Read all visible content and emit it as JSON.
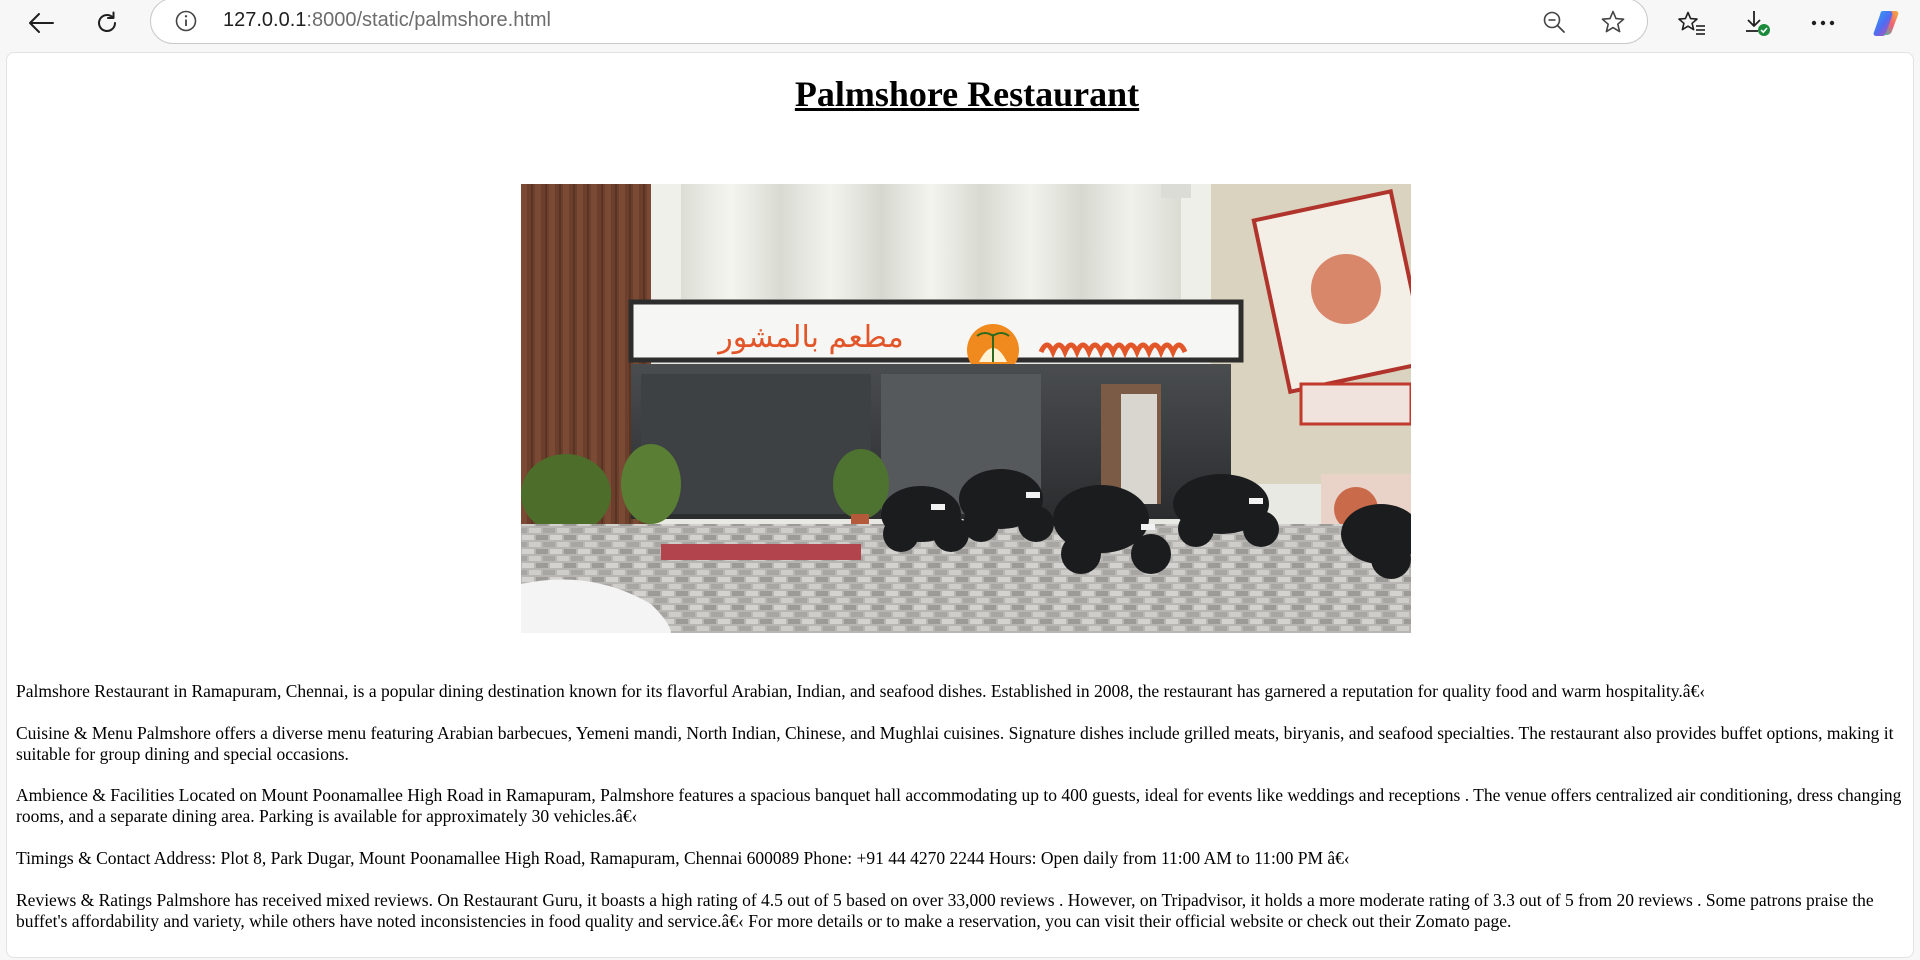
{
  "browser": {
    "url_host": "127.0.0.1",
    "url_path": ":8000/static/palmshore.html",
    "icons": [
      "back-arrow-icon",
      "refresh-icon",
      "site-info-icon",
      "zoom-out-icon",
      "favorite-star-icon",
      "favorites-list-icon",
      "downloads-icon",
      "more-menu-icon",
      "copilot-icon"
    ]
  },
  "page": {
    "title": "Palmshore Restaurant",
    "image_alt": "Palmshore Restaurant storefront",
    "sign_arabic": "مطعم بالمشور",
    "paragraphs": [
      "Palmshore Restaurant in Ramapuram, Chennai, is a popular dining destination known for its flavorful Arabian, Indian, and seafood dishes. Established in 2008, the restaurant has garnered a reputation for quality food and warm hospitality.â€‹",
      "Cuisine & Menu Palmshore offers a diverse menu featuring Arabian barbecues, Yemeni mandi, North Indian, Chinese, and Mughlai cuisines. Signature dishes include grilled meats, biryanis, and seafood specialties. The restaurant also provides buffet options, making it suitable for group dining and special occasions.",
      "Ambience & Facilities Located on Mount Poonamallee High Road in Ramapuram, Palmshore features a spacious banquet hall accommodating up to 400 guests, ideal for events like weddings and receptions . The venue offers centralized air conditioning, dress changing rooms, and a separate dining area. Parking is available for approximately 30 vehicles.â€‹",
      "Timings & Contact Address: Plot 8, Park Dugar, Mount Poonamallee High Road, Ramapuram, Chennai 600089 Phone: +91 44 4270 2244 Hours: Open daily from 11:00 AM to 11:00 PM â€‹",
      "Reviews & Ratings Palmshore has received mixed reviews. On Restaurant Guru, it boasts a high rating of 4.5 out of 5 based on over 33,000 reviews . However, on Tripadvisor, it holds a more moderate rating of 3.3 out of 5 from 20 reviews . Some patrons praise the buffet's affordability and variety, while others have noted inconsistencies in food quality and service.â€‹ For more details or to make a reservation, you can visit their official website or check out their Zomato page."
    ]
  }
}
